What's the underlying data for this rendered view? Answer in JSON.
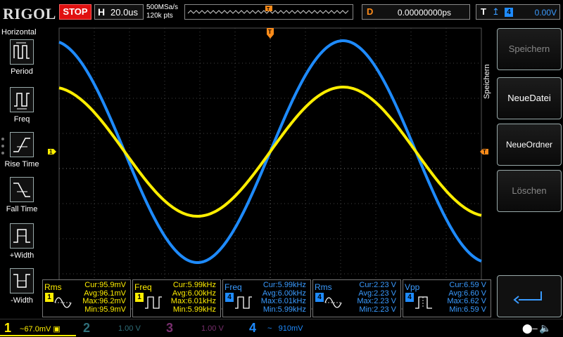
{
  "header": {
    "logo": "RIGOL",
    "run_state": "STOP",
    "timebase_label": "H",
    "timebase_value": "20.0us",
    "sample_rate": "500MSa/s",
    "memory_depth": "120k pts",
    "delay_label": "D",
    "delay_value": "0.00000000ps",
    "trigger_label": "T",
    "trigger_source": "4",
    "trigger_level": "0.00V"
  },
  "left_menu": {
    "title": "Horizontal",
    "items": [
      {
        "label": "Period",
        "icon": "period-icon"
      },
      {
        "label": "Freq",
        "icon": "freq-icon"
      },
      {
        "label": "Rise Time",
        "icon": "rise-time-icon"
      },
      {
        "label": "Fall Time",
        "icon": "fall-time-icon"
      },
      {
        "label": "+Width",
        "icon": "pos-width-icon"
      },
      {
        "label": "-Width",
        "icon": "neg-width-icon"
      }
    ]
  },
  "right_menu": {
    "title": "Speichern",
    "buttons": [
      {
        "label": "Speichern",
        "state": "disabled"
      },
      {
        "label": "NeueDatei",
        "state": "enabled"
      },
      {
        "label": "NeueOrdner",
        "state": "enabled"
      },
      {
        "label": "Löschen",
        "state": "disabled"
      }
    ],
    "back_icon": "return-arrow-icon"
  },
  "plot": {
    "ch1_marker": "1",
    "trigger_marker": "T",
    "trigger_level_marker": "T"
  },
  "measurements": [
    {
      "name": "Rms",
      "channel": "1",
      "cur": "Cur:95.9mV",
      "avg": "Avg:96.1mV",
      "max": "Max:96.2mV",
      "min": "Min:95.9mV"
    },
    {
      "name": "Freq",
      "channel": "1",
      "cur": "Cur:5.99kHz",
      "avg": "Avg:6.00kHz",
      "max": "Max:6.01kHz",
      "min": "Min:5.99kHz"
    },
    {
      "name": "Freq",
      "channel": "4",
      "cur": "Cur:5.99kHz",
      "avg": "Avg:6.00kHz",
      "max": "Max:6.01kHz",
      "min": "Min:5.99kHz"
    },
    {
      "name": "Rms",
      "channel": "4",
      "cur": "Cur:2.23 V",
      "avg": "Avg:2.23 V",
      "max": "Max:2.23 V",
      "min": "Min:2.23 V"
    },
    {
      "name": "Vpp",
      "channel": "4",
      "cur": "Cur:6.59 V",
      "avg": "Avg:6.60 V",
      "max": "Max:6.62 V",
      "min": "Min:6.59 V"
    }
  ],
  "channels": [
    {
      "num": "1",
      "scale": "67.0mV",
      "color": "#ffee00"
    },
    {
      "num": "2",
      "scale": "1.00 V",
      "color": "#2f6f7a"
    },
    {
      "num": "3",
      "scale": "1.00 V",
      "color": "#7a2f6f"
    },
    {
      "num": "4",
      "scale": "910mV",
      "color": "#1e8bff"
    }
  ],
  "colors": {
    "ch1": "#ffee00",
    "ch4": "#1e8bff",
    "trigger": "#ff8c1a",
    "stop": "#e01010"
  }
}
